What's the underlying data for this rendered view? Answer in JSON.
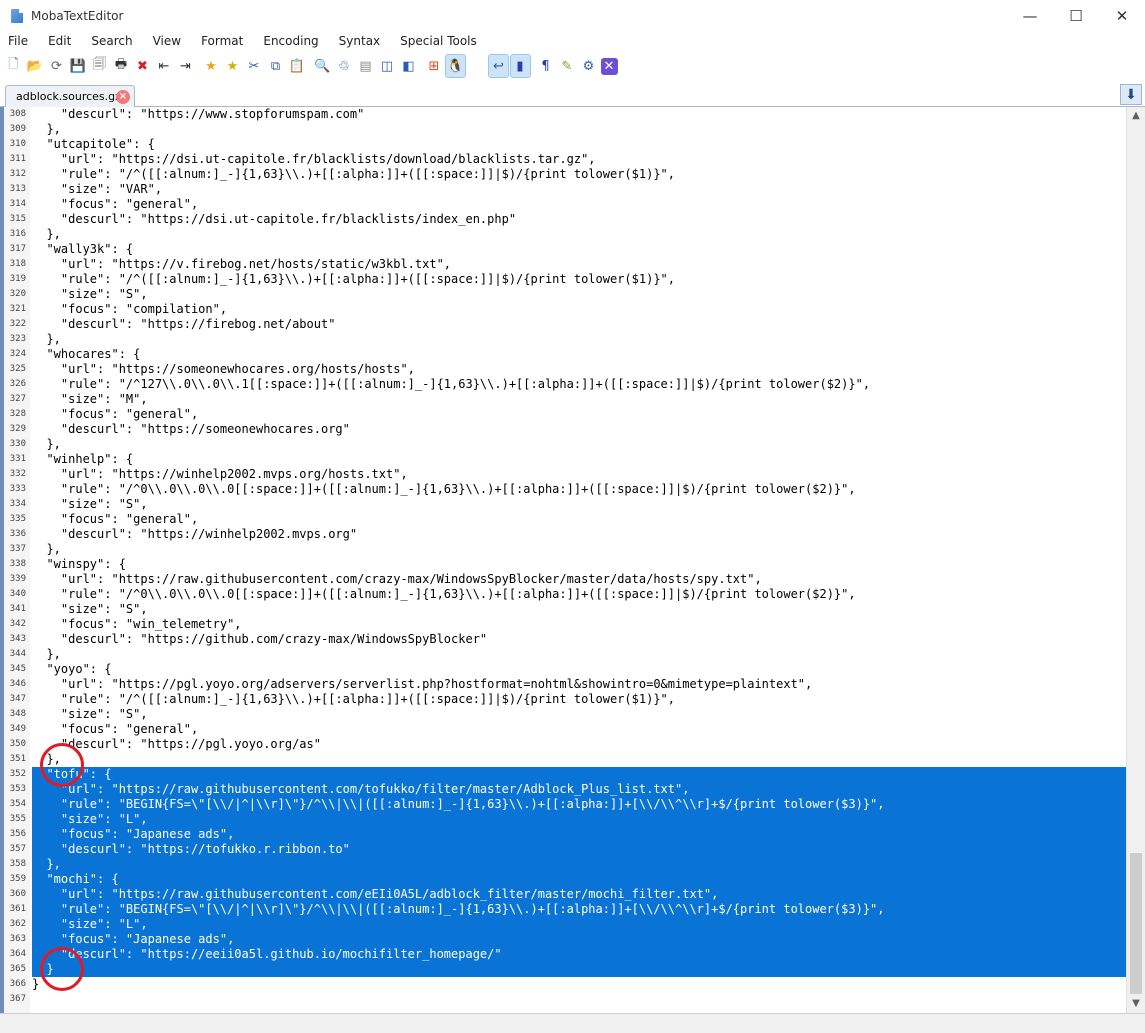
{
  "window": {
    "title": "MobaTextEditor",
    "minimize": "—",
    "maximize": "☐",
    "close": "✕"
  },
  "menu": [
    "File",
    "Edit",
    "Search",
    "View",
    "Format",
    "Encoding",
    "Syntax",
    "Special Tools"
  ],
  "toolbar": [
    {
      "name": "new-file-icon",
      "glyph": "🗋",
      "color": "#4a7fc0"
    },
    {
      "name": "open-folder-icon",
      "glyph": "📂",
      "color": "#e0a22a"
    },
    {
      "name": "reload-icon",
      "glyph": "⟳",
      "color": "#666"
    },
    {
      "name": "save-icon",
      "glyph": "💾",
      "color": "#666"
    },
    {
      "name": "save-all-icon",
      "glyph": "🗐",
      "color": "#666"
    },
    {
      "name": "print-icon",
      "glyph": "🖶",
      "color": "#333"
    },
    {
      "name": "close-file-icon",
      "glyph": "✖",
      "color": "#e01b24"
    },
    {
      "name": "indent-left-icon",
      "glyph": "⇤",
      "color": "#333"
    },
    {
      "name": "indent-right-icon",
      "glyph": "⇥",
      "color": "#333"
    },
    {
      "name": "bookmark-add-icon",
      "glyph": "★",
      "color": "#e8a317"
    },
    {
      "name": "bookmark-next-icon",
      "glyph": "★",
      "color": "#d4b300"
    },
    {
      "name": "cut-icon",
      "glyph": "✂",
      "color": "#2a5db0"
    },
    {
      "name": "copy-icon",
      "glyph": "⧉",
      "color": "#2a5db0"
    },
    {
      "name": "paste-icon",
      "glyph": "📋",
      "color": "#888"
    },
    {
      "name": "search-icon",
      "glyph": "🔍",
      "color": "#2a5db0"
    },
    {
      "name": "replace-icon",
      "glyph": "♲",
      "color": "#2a5db0"
    },
    {
      "name": "compare-icon",
      "glyph": "▤",
      "color": "#888"
    },
    {
      "name": "window-split-icon",
      "glyph": "◫",
      "color": "#2a5db0"
    },
    {
      "name": "window-tile-icon",
      "glyph": "◧",
      "color": "#2a5db0"
    },
    {
      "name": "windows-eol-icon",
      "glyph": "⊞",
      "color": "#e04a1a"
    },
    {
      "name": "linux-eol-icon",
      "glyph": "🐧",
      "color": "#222"
    },
    {
      "name": "mac-eol-icon",
      "glyph": "",
      "color": "#2a7de0"
    },
    {
      "name": "word-wrap-icon",
      "glyph": "↩",
      "color": "#2a5db0"
    },
    {
      "name": "column-mode-icon",
      "glyph": "▮",
      "color": "#2a3db0"
    },
    {
      "name": "show-symbols-icon",
      "glyph": "¶",
      "color": "#2a3db0"
    },
    {
      "name": "highlight-icon",
      "glyph": "✎",
      "color": "#6aa82a"
    },
    {
      "name": "settings-icon",
      "glyph": "⚙",
      "color": "#2a5db0"
    },
    {
      "name": "exit-icon",
      "glyph": "✕",
      "color": "#ffffff"
    }
  ],
  "tab": {
    "label": "adblock.sources.gz",
    "close": "×"
  },
  "tab_scroll": "⬇",
  "scrollbar": {
    "up": "▲",
    "down": "▼"
  },
  "editor": {
    "lines": [
      {
        "n": "308",
        "text": "    \"descurl\": \"https://www.stopforumspam.com\""
      },
      {
        "n": "309",
        "text": "  },"
      },
      {
        "n": "310",
        "text": "  \"utcapitole\": {"
      },
      {
        "n": "311",
        "text": "    \"url\": \"https://dsi.ut-capitole.fr/blacklists/download/blacklists.tar.gz\","
      },
      {
        "n": "312",
        "text": "    \"rule\": \"/^([[:alnum:]_-]{1,63}\\\\.)+[[:alpha:]]+([[:space:]]|$)/{print tolower($1)}\","
      },
      {
        "n": "313",
        "text": "    \"size\": \"VAR\","
      },
      {
        "n": "314",
        "text": "    \"focus\": \"general\","
      },
      {
        "n": "315",
        "text": "    \"descurl\": \"https://dsi.ut-capitole.fr/blacklists/index_en.php\""
      },
      {
        "n": "316",
        "text": "  },"
      },
      {
        "n": "317",
        "text": "  \"wally3k\": {"
      },
      {
        "n": "318",
        "text": "    \"url\": \"https://v.firebog.net/hosts/static/w3kbl.txt\","
      },
      {
        "n": "319",
        "text": "    \"rule\": \"/^([[:alnum:]_-]{1,63}\\\\.)+[[:alpha:]]+([[:space:]]|$)/{print tolower($1)}\","
      },
      {
        "n": "320",
        "text": "    \"size\": \"S\","
      },
      {
        "n": "321",
        "text": "    \"focus\": \"compilation\","
      },
      {
        "n": "322",
        "text": "    \"descurl\": \"https://firebog.net/about\""
      },
      {
        "n": "323",
        "text": "  },"
      },
      {
        "n": "324",
        "text": "  \"whocares\": {"
      },
      {
        "n": "325",
        "text": "    \"url\": \"https://someonewhocares.org/hosts/hosts\","
      },
      {
        "n": "326",
        "text": "    \"rule\": \"/^127\\\\.0\\\\.0\\\\.1[[:space:]]+([[:alnum:]_-]{1,63}\\\\.)+[[:alpha:]]+([[:space:]]|$)/{print tolower($2)}\","
      },
      {
        "n": "327",
        "text": "    \"size\": \"M\","
      },
      {
        "n": "328",
        "text": "    \"focus\": \"general\","
      },
      {
        "n": "329",
        "text": "    \"descurl\": \"https://someonewhocares.org\""
      },
      {
        "n": "330",
        "text": "  },"
      },
      {
        "n": "331",
        "text": "  \"winhelp\": {"
      },
      {
        "n": "332",
        "text": "    \"url\": \"https://winhelp2002.mvps.org/hosts.txt\","
      },
      {
        "n": "333",
        "text": "    \"rule\": \"/^0\\\\.0\\\\.0\\\\.0[[:space:]]+([[:alnum:]_-]{1,63}\\\\.)+[[:alpha:]]+([[:space:]]|$)/{print tolower($2)}\","
      },
      {
        "n": "334",
        "text": "    \"size\": \"S\","
      },
      {
        "n": "335",
        "text": "    \"focus\": \"general\","
      },
      {
        "n": "336",
        "text": "    \"descurl\": \"https://winhelp2002.mvps.org\""
      },
      {
        "n": "337",
        "text": "  },"
      },
      {
        "n": "338",
        "text": "  \"winspy\": {"
      },
      {
        "n": "339",
        "text": "    \"url\": \"https://raw.githubusercontent.com/crazy-max/WindowsSpyBlocker/master/data/hosts/spy.txt\","
      },
      {
        "n": "340",
        "text": "    \"rule\": \"/^0\\\\.0\\\\.0\\\\.0[[:space:]]+([[:alnum:]_-]{1,63}\\\\.)+[[:alpha:]]+([[:space:]]|$)/{print tolower($2)}\","
      },
      {
        "n": "341",
        "text": "    \"size\": \"S\","
      },
      {
        "n": "342",
        "text": "    \"focus\": \"win_telemetry\","
      },
      {
        "n": "343",
        "text": "    \"descurl\": \"https://github.com/crazy-max/WindowsSpyBlocker\""
      },
      {
        "n": "344",
        "text": "  },"
      },
      {
        "n": "345",
        "text": "  \"yoyo\": {"
      },
      {
        "n": "346",
        "text": "    \"url\": \"https://pgl.yoyo.org/adservers/serverlist.php?hostformat=nohtml&showintro=0&mimetype=plaintext\","
      },
      {
        "n": "347",
        "text": "    \"rule\": \"/^([[:alnum:]_-]{1,63}\\\\.)+[[:alpha:]]+([[:space:]]|$)/{print tolower($1)}\","
      },
      {
        "n": "348",
        "text": "    \"size\": \"S\","
      },
      {
        "n": "349",
        "text": "    \"focus\": \"general\","
      },
      {
        "n": "350",
        "text": "    \"descurl\": \"https://pgl.yoyo.org/as\""
      },
      {
        "n": "351",
        "text": "  },"
      },
      {
        "n": "352",
        "text": "  \"tofu\": {",
        "sel": true
      },
      {
        "n": "353",
        "text": "    \"url\": \"https://raw.githubusercontent.com/tofukko/filter/master/Adblock_Plus_list.txt\",",
        "sel": true
      },
      {
        "n": "354",
        "text": "    \"rule\": \"BEGIN{FS=\\\"[\\\\/|^|\\\\r]\\\"}/^\\\\|\\\\|([[:alnum:]_-]{1,63}\\\\.)+[[:alpha:]]+[\\\\/\\\\^\\\\r]+$/{print tolower($3)}\",",
        "sel": true
      },
      {
        "n": "355",
        "text": "    \"size\": \"L\",",
        "sel": true
      },
      {
        "n": "356",
        "text": "    \"focus\": \"Japanese ads\",",
        "sel": true
      },
      {
        "n": "357",
        "text": "    \"descurl\": \"https://tofukko.r.ribbon.to\"",
        "sel": true
      },
      {
        "n": "358",
        "text": "  },",
        "sel": true
      },
      {
        "n": "359",
        "text": "  \"mochi\": {",
        "sel": true
      },
      {
        "n": "360",
        "text": "    \"url\": \"https://raw.githubusercontent.com/eEIi0A5L/adblock_filter/master/mochi_filter.txt\",",
        "sel": true
      },
      {
        "n": "361",
        "text": "    \"rule\": \"BEGIN{FS=\\\"[\\\\/|^|\\\\r]\\\"}/^\\\\|\\\\|([[:alnum:]_-]{1,63}\\\\.)+[[:alpha:]]+[\\\\/\\\\^\\\\r]+$/{print tolower($3)}\",",
        "sel": true
      },
      {
        "n": "362",
        "text": "    \"size\": \"L\",",
        "sel": true
      },
      {
        "n": "363",
        "text": "    \"focus\": \"Japanese ads\",",
        "sel": true
      },
      {
        "n": "364",
        "text": "    \"descurl\": \"https://eeii0a5l.github.io/mochifilter_homepage/\"",
        "sel": true
      },
      {
        "n": "365",
        "text": "  }",
        "sel": true
      },
      {
        "n": "366",
        "text": "}"
      },
      {
        "n": "367",
        "text": ""
      }
    ]
  }
}
